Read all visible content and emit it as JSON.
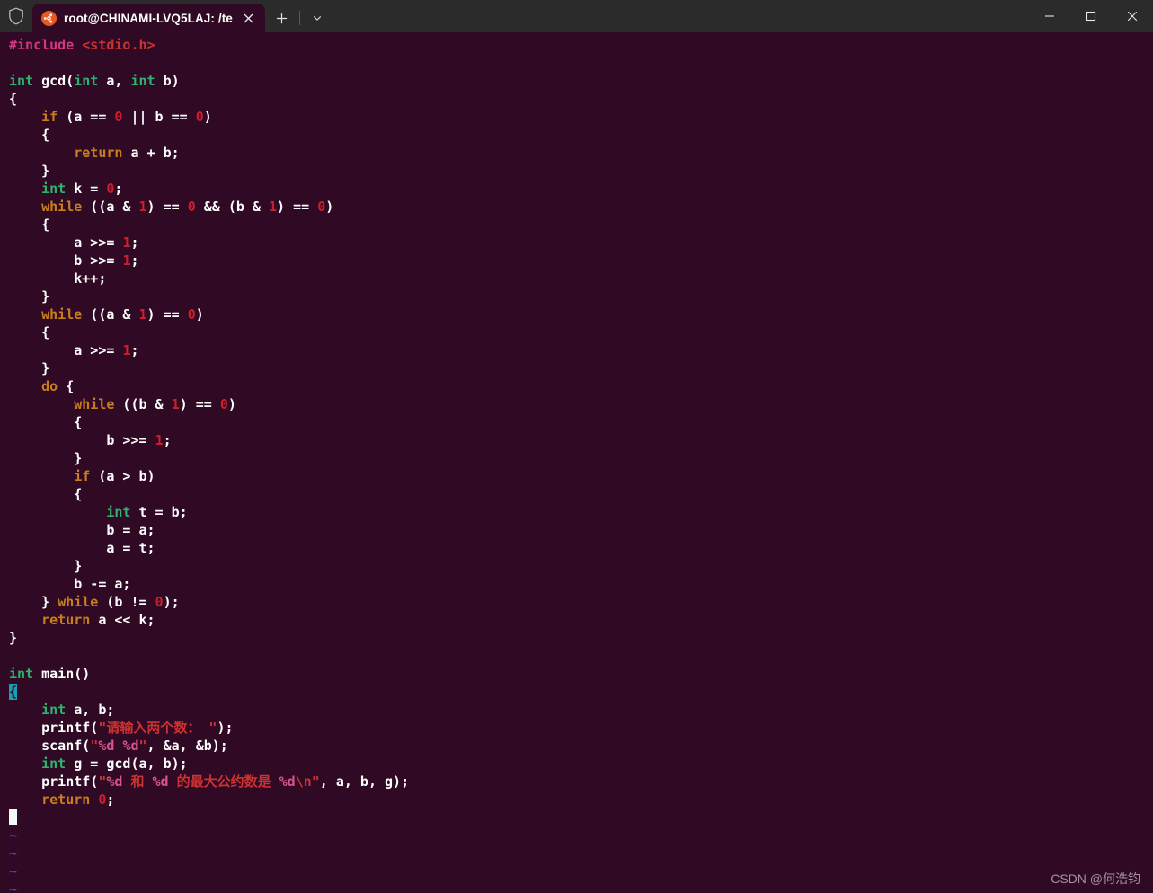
{
  "window": {
    "titlebar_bg": "#2b2b2b",
    "terminal_bg": "#300a24",
    "shield_icon": "shield-icon",
    "controls": {
      "minimize": "minimize-icon",
      "maximize": "maximize-icon",
      "close": "close-icon"
    }
  },
  "tabs": {
    "active": {
      "title": "root@CHINAMI-LVQ5LAJ: /te",
      "favicon": "ubuntu-logo-icon",
      "close": "tab-close-icon"
    },
    "new_tab_label": "+",
    "dropdown_label": "chevron-down-icon"
  },
  "editor": {
    "cursor_line_index": 37,
    "cursor_char": "{",
    "filler_char": "~",
    "lines": [
      {
        "i": 1,
        "segs": [
          {
            "t": "#include ",
            "c": "c-pre"
          },
          {
            "t": "<stdio.h>",
            "c": "c-inc"
          }
        ]
      },
      {
        "i": 2,
        "segs": []
      },
      {
        "i": 3,
        "segs": [
          {
            "t": "int ",
            "c": "c-type"
          },
          {
            "t": "gcd(",
            "c": "c-plain"
          },
          {
            "t": "int ",
            "c": "c-type"
          },
          {
            "t": "a, ",
            "c": "c-plain"
          },
          {
            "t": "int ",
            "c": "c-type"
          },
          {
            "t": "b)",
            "c": "c-plain"
          }
        ]
      },
      {
        "i": 4,
        "segs": [
          {
            "t": "{",
            "c": "c-plain"
          }
        ]
      },
      {
        "i": 5,
        "segs": [
          {
            "t": "    ",
            "c": "c-plain"
          },
          {
            "t": "if",
            "c": "c-kw"
          },
          {
            "t": " (a == ",
            "c": "c-plain"
          },
          {
            "t": "0",
            "c": "c-num"
          },
          {
            "t": " || b == ",
            "c": "c-plain"
          },
          {
            "t": "0",
            "c": "c-num"
          },
          {
            "t": ")",
            "c": "c-plain"
          }
        ]
      },
      {
        "i": 6,
        "segs": [
          {
            "t": "    {",
            "c": "c-plain"
          }
        ]
      },
      {
        "i": 7,
        "segs": [
          {
            "t": "        ",
            "c": "c-plain"
          },
          {
            "t": "return",
            "c": "c-kw"
          },
          {
            "t": " a + b;",
            "c": "c-plain"
          }
        ]
      },
      {
        "i": 8,
        "segs": [
          {
            "t": "    }",
            "c": "c-plain"
          }
        ]
      },
      {
        "i": 9,
        "segs": [
          {
            "t": "    ",
            "c": "c-plain"
          },
          {
            "t": "int",
            "c": "c-type"
          },
          {
            "t": " k = ",
            "c": "c-plain"
          },
          {
            "t": "0",
            "c": "c-num"
          },
          {
            "t": ";",
            "c": "c-plain"
          }
        ]
      },
      {
        "i": 10,
        "segs": [
          {
            "t": "    ",
            "c": "c-plain"
          },
          {
            "t": "while",
            "c": "c-kw"
          },
          {
            "t": " ((a & ",
            "c": "c-plain"
          },
          {
            "t": "1",
            "c": "c-num"
          },
          {
            "t": ") == ",
            "c": "c-plain"
          },
          {
            "t": "0",
            "c": "c-num"
          },
          {
            "t": " && (b & ",
            "c": "c-plain"
          },
          {
            "t": "1",
            "c": "c-num"
          },
          {
            "t": ") == ",
            "c": "c-plain"
          },
          {
            "t": "0",
            "c": "c-num"
          },
          {
            "t": ")",
            "c": "c-plain"
          }
        ]
      },
      {
        "i": 11,
        "segs": [
          {
            "t": "    {",
            "c": "c-plain"
          }
        ]
      },
      {
        "i": 12,
        "segs": [
          {
            "t": "        a >>= ",
            "c": "c-plain"
          },
          {
            "t": "1",
            "c": "c-num"
          },
          {
            "t": ";",
            "c": "c-plain"
          }
        ]
      },
      {
        "i": 13,
        "segs": [
          {
            "t": "        b >>= ",
            "c": "c-plain"
          },
          {
            "t": "1",
            "c": "c-num"
          },
          {
            "t": ";",
            "c": "c-plain"
          }
        ]
      },
      {
        "i": 14,
        "segs": [
          {
            "t": "        k++;",
            "c": "c-plain"
          }
        ]
      },
      {
        "i": 15,
        "segs": [
          {
            "t": "    }",
            "c": "c-plain"
          }
        ]
      },
      {
        "i": 16,
        "segs": [
          {
            "t": "    ",
            "c": "c-plain"
          },
          {
            "t": "while",
            "c": "c-kw"
          },
          {
            "t": " ((a & ",
            "c": "c-plain"
          },
          {
            "t": "1",
            "c": "c-num"
          },
          {
            "t": ") == ",
            "c": "c-plain"
          },
          {
            "t": "0",
            "c": "c-num"
          },
          {
            "t": ")",
            "c": "c-plain"
          }
        ]
      },
      {
        "i": 17,
        "segs": [
          {
            "t": "    {",
            "c": "c-plain"
          }
        ]
      },
      {
        "i": 18,
        "segs": [
          {
            "t": "        a >>= ",
            "c": "c-plain"
          },
          {
            "t": "1",
            "c": "c-num"
          },
          {
            "t": ";",
            "c": "c-plain"
          }
        ]
      },
      {
        "i": 19,
        "segs": [
          {
            "t": "    }",
            "c": "c-plain"
          }
        ]
      },
      {
        "i": 20,
        "segs": [
          {
            "t": "    ",
            "c": "c-plain"
          },
          {
            "t": "do",
            "c": "c-kw"
          },
          {
            "t": " {",
            "c": "c-plain"
          }
        ]
      },
      {
        "i": 21,
        "segs": [
          {
            "t": "        ",
            "c": "c-plain"
          },
          {
            "t": "while",
            "c": "c-kw"
          },
          {
            "t": " ((b & ",
            "c": "c-plain"
          },
          {
            "t": "1",
            "c": "c-num"
          },
          {
            "t": ") == ",
            "c": "c-plain"
          },
          {
            "t": "0",
            "c": "c-num"
          },
          {
            "t": ")",
            "c": "c-plain"
          }
        ]
      },
      {
        "i": 22,
        "segs": [
          {
            "t": "        {",
            "c": "c-plain"
          }
        ]
      },
      {
        "i": 23,
        "segs": [
          {
            "t": "            b >>= ",
            "c": "c-plain"
          },
          {
            "t": "1",
            "c": "c-num"
          },
          {
            "t": ";",
            "c": "c-plain"
          }
        ]
      },
      {
        "i": 24,
        "segs": [
          {
            "t": "        }",
            "c": "c-plain"
          }
        ]
      },
      {
        "i": 25,
        "segs": [
          {
            "t": "        ",
            "c": "c-plain"
          },
          {
            "t": "if",
            "c": "c-kw"
          },
          {
            "t": " (a > b)",
            "c": "c-plain"
          }
        ]
      },
      {
        "i": 26,
        "segs": [
          {
            "t": "        {",
            "c": "c-plain"
          }
        ]
      },
      {
        "i": 27,
        "segs": [
          {
            "t": "            ",
            "c": "c-plain"
          },
          {
            "t": "int",
            "c": "c-type"
          },
          {
            "t": " t = b;",
            "c": "c-plain"
          }
        ]
      },
      {
        "i": 28,
        "segs": [
          {
            "t": "            b = a;",
            "c": "c-plain"
          }
        ]
      },
      {
        "i": 29,
        "segs": [
          {
            "t": "            a = t;",
            "c": "c-plain"
          }
        ]
      },
      {
        "i": 30,
        "segs": [
          {
            "t": "        }",
            "c": "c-plain"
          }
        ]
      },
      {
        "i": 31,
        "segs": [
          {
            "t": "        b -= a;",
            "c": "c-plain"
          }
        ]
      },
      {
        "i": 32,
        "segs": [
          {
            "t": "    } ",
            "c": "c-plain"
          },
          {
            "t": "while",
            "c": "c-kw"
          },
          {
            "t": " (b != ",
            "c": "c-plain"
          },
          {
            "t": "0",
            "c": "c-num"
          },
          {
            "t": ");",
            "c": "c-plain"
          }
        ]
      },
      {
        "i": 33,
        "segs": [
          {
            "t": "    ",
            "c": "c-plain"
          },
          {
            "t": "return",
            "c": "c-kw"
          },
          {
            "t": " a << k;",
            "c": "c-plain"
          }
        ]
      },
      {
        "i": 34,
        "segs": [
          {
            "t": "}",
            "c": "c-plain"
          }
        ]
      },
      {
        "i": 35,
        "segs": []
      },
      {
        "i": 36,
        "segs": [
          {
            "t": "int ",
            "c": "c-type"
          },
          {
            "t": "main()",
            "c": "c-plain"
          }
        ]
      },
      {
        "i": 37,
        "segs": [
          {
            "t": "{",
            "c": "cursor-block"
          }
        ]
      },
      {
        "i": 38,
        "segs": [
          {
            "t": "    ",
            "c": "c-plain"
          },
          {
            "t": "int",
            "c": "c-type"
          },
          {
            "t": " a, b;",
            "c": "c-plain"
          }
        ]
      },
      {
        "i": 39,
        "segs": [
          {
            "t": "    printf(",
            "c": "c-plain"
          },
          {
            "t": "\"请输入两个数： \"",
            "c": "c-str"
          },
          {
            "t": ");",
            "c": "c-plain"
          }
        ]
      },
      {
        "i": 40,
        "segs": [
          {
            "t": "    scanf(",
            "c": "c-plain"
          },
          {
            "t": "\"",
            "c": "c-str"
          },
          {
            "t": "%d",
            "c": "c-fmt"
          },
          {
            "t": " ",
            "c": "c-str"
          },
          {
            "t": "%d",
            "c": "c-fmt"
          },
          {
            "t": "\"",
            "c": "c-str"
          },
          {
            "t": ", &a, &b);",
            "c": "c-plain"
          }
        ]
      },
      {
        "i": 41,
        "segs": [
          {
            "t": "    ",
            "c": "c-plain"
          },
          {
            "t": "int",
            "c": "c-type"
          },
          {
            "t": " g = gcd(a, b);",
            "c": "c-plain"
          }
        ]
      },
      {
        "i": 42,
        "segs": [
          {
            "t": "    printf(",
            "c": "c-plain"
          },
          {
            "t": "\"",
            "c": "c-str"
          },
          {
            "t": "%d",
            "c": "c-fmt"
          },
          {
            "t": " 和 ",
            "c": "c-str"
          },
          {
            "t": "%d",
            "c": "c-fmt"
          },
          {
            "t": " 的最大公约数是 ",
            "c": "c-str"
          },
          {
            "t": "%d",
            "c": "c-fmt"
          },
          {
            "t": "\\n\"",
            "c": "c-str"
          },
          {
            "t": ", a, b, g);",
            "c": "c-plain"
          }
        ]
      },
      {
        "i": 43,
        "segs": [
          {
            "t": "    ",
            "c": "c-plain"
          },
          {
            "t": "return",
            "c": "c-kw"
          },
          {
            "t": " ",
            "c": "c-plain"
          },
          {
            "t": "0",
            "c": "c-num"
          },
          {
            "t": ";",
            "c": "c-plain"
          }
        ]
      }
    ],
    "filler_lines": 4
  },
  "watermark": {
    "text": "CSDN @何浩钧"
  }
}
